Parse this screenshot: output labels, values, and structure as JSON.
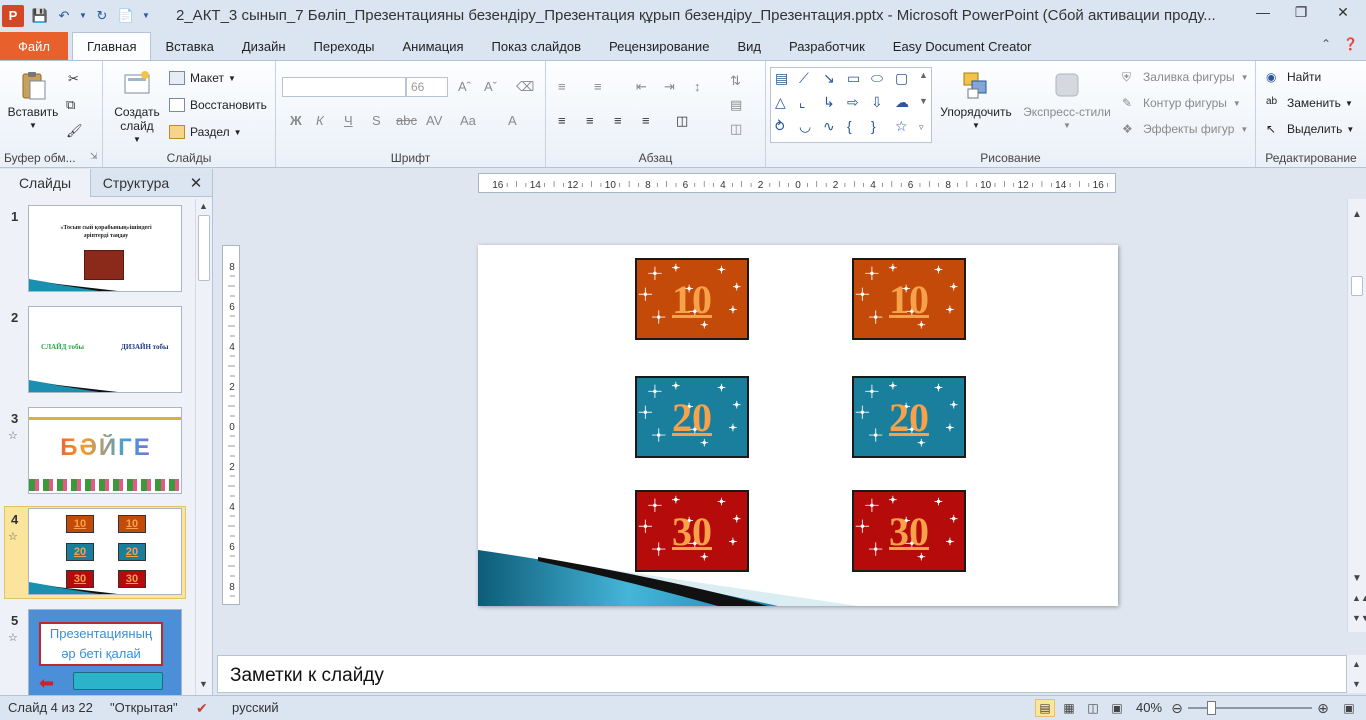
{
  "window": {
    "title": "2_АКТ_3 сынып_7 Бөліп_Презентацияны безендіру_Презентация құрып безендіру_Презентация.pptx - Microsoft PowerPoint (Сбой активации проду...",
    "app_logo": "P"
  },
  "tabs": [
    "Файл",
    "Главная",
    "Вставка",
    "Дизайн",
    "Переходы",
    "Анимация",
    "Показ слайдов",
    "Рецензирование",
    "Вид",
    "Разработчик",
    "Easy Document Creator"
  ],
  "ribbon": {
    "clipboard": {
      "paste": "Вставить",
      "label": "Буфер обм..."
    },
    "slides": {
      "new_slide": "Создать слайд",
      "layout": "Макет",
      "reset": "Восстановить",
      "section": "Раздел",
      "label": "Слайды"
    },
    "font": {
      "size": "66",
      "label": "Шрифт"
    },
    "paragraph": {
      "label": "Абзац"
    },
    "drawing": {
      "arrange": "Упорядочить",
      "quick_styles": "Экспресс-стили",
      "fill": "Заливка фигуры",
      "outline": "Контур фигуры",
      "effects": "Эффекты фигур",
      "label": "Рисование"
    },
    "editing": {
      "find": "Найти",
      "replace": "Заменить",
      "select": "Выделить",
      "label": "Редактирование"
    }
  },
  "panel": {
    "tab_slides": "Слайды",
    "tab_outline": "Структура",
    "close": "✕"
  },
  "thumbnails": [
    {
      "num": "1",
      "title": "«Тосын сый қорабының»ішіндегі\nәріптерді таңдау"
    },
    {
      "num": "2",
      "left": "СЛАЙД тобы",
      "right": "ДИЗАЙН тобы"
    },
    {
      "num": "3",
      "title": "БӘЙГЕ"
    },
    {
      "num": "4"
    },
    {
      "num": "5",
      "title": "Презентацияның әр беті қалай аталады?"
    }
  ],
  "slide": {
    "cards": [
      {
        "value": "10",
        "color": "#c44a09"
      },
      {
        "value": "10",
        "color": "#c44a09"
      },
      {
        "value": "20",
        "color": "#1a7f9c"
      },
      {
        "value": "20",
        "color": "#1a7f9c"
      },
      {
        "value": "30",
        "color": "#b50b0b"
      },
      {
        "value": "30",
        "color": "#b50b0b"
      }
    ]
  },
  "ruler": {
    "h_labels": [
      "16",
      "14",
      "12",
      "10",
      "8",
      "6",
      "4",
      "2",
      "0",
      "2",
      "4",
      "6",
      "8",
      "10",
      "12",
      "14",
      "16"
    ],
    "v_labels": [
      "8",
      "6",
      "4",
      "2",
      "0",
      "2",
      "4",
      "6",
      "8"
    ]
  },
  "notes": {
    "placeholder": "Заметки к слайду"
  },
  "status": {
    "slide_info": "Слайд 4 из 22",
    "theme": "\"Открытая\"",
    "language": "русский",
    "zoom": "40%"
  }
}
